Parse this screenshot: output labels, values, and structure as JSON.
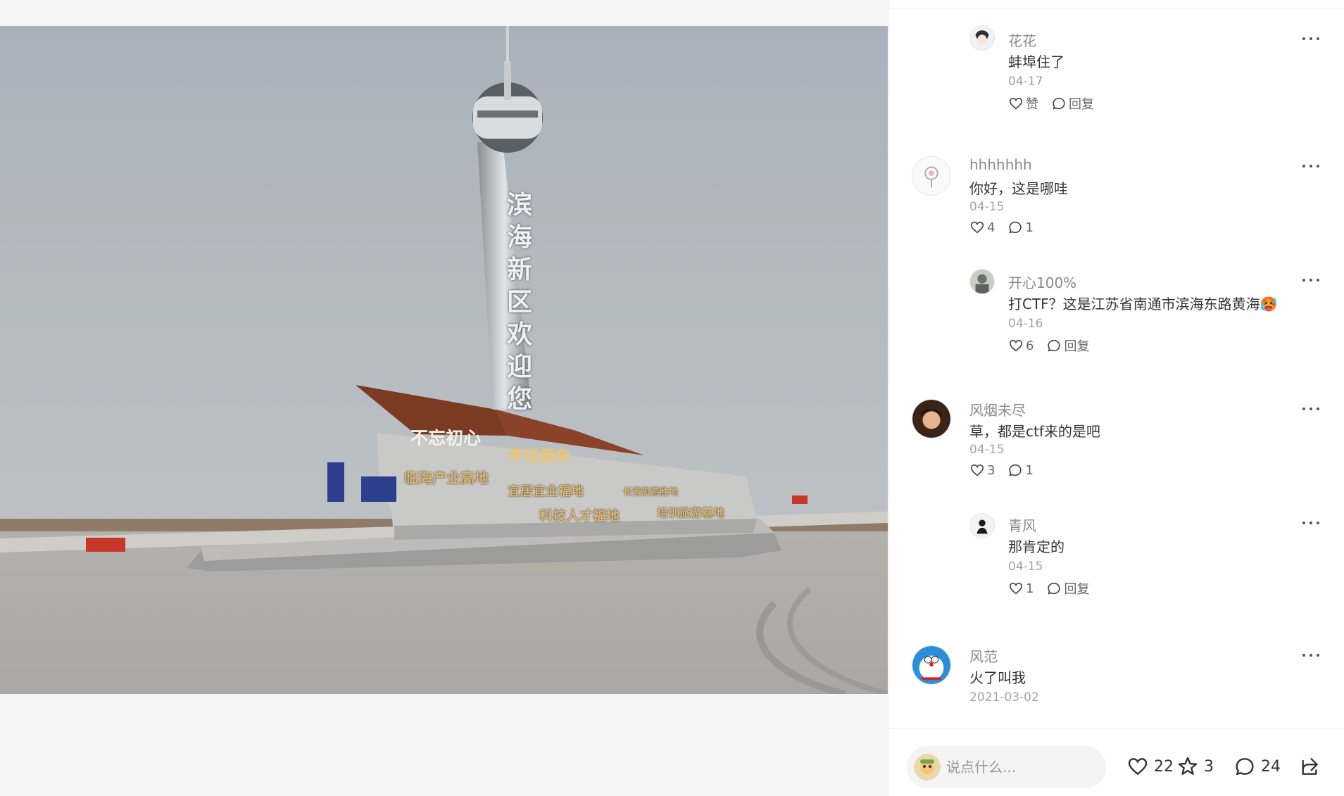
{
  "media": {
    "tower_sign": "滨海新区欢迎您",
    "sign_main": "不忘初心",
    "sign_sub": "牢记使命",
    "sign_row_a": "临海产业高地",
    "sign_row_b": "宜居宜业福地",
    "sign_row_c": "长青旅游胜地",
    "sign_row_d": "科技人才福地",
    "sign_row_e": "培训旅游基地"
  },
  "comments": [
    {
      "author": "花花",
      "content": "蚌埠住了",
      "date": "04-17",
      "like_label": "赞",
      "reply_label": "回复",
      "avatar_icon": "cartoon-girl-avatar"
    },
    {
      "author": "hhhhhhh",
      "content": "你好，这是哪哇",
      "date": "04-15",
      "like_count": "4",
      "reply_count": "1",
      "avatar_icon": "lollipop-avatar"
    },
    {
      "author": "开心100%",
      "content": "打CTF？这是江苏省南通市滨海东路黄海🥵",
      "date": "04-16",
      "like_count": "6",
      "reply_label": "回复",
      "avatar_icon": "photo-avatar"
    },
    {
      "author": "风烟未尽",
      "content": "草，都是ctf来的是吧",
      "date": "04-15",
      "like_count": "3",
      "reply_count": "1",
      "avatar_icon": "anime-boy-avatar"
    },
    {
      "author": "青风",
      "content": "那肯定的",
      "date": "04-15",
      "like_count": "1",
      "reply_label": "回复",
      "avatar_icon": "silhouette-avatar"
    },
    {
      "author": "风范",
      "content": "火了叫我",
      "date": "2021-03-02",
      "avatar_icon": "doraemon-avatar"
    }
  ],
  "bottom_bar": {
    "input_placeholder": "说点什么...",
    "like_count": "22",
    "star_count": "3",
    "comment_count": "24"
  },
  "colors": {
    "text_primary": "#333333",
    "text_secondary": "#8a8a8a",
    "divider": "#ececec",
    "input_bg": "#f4f4f4"
  }
}
